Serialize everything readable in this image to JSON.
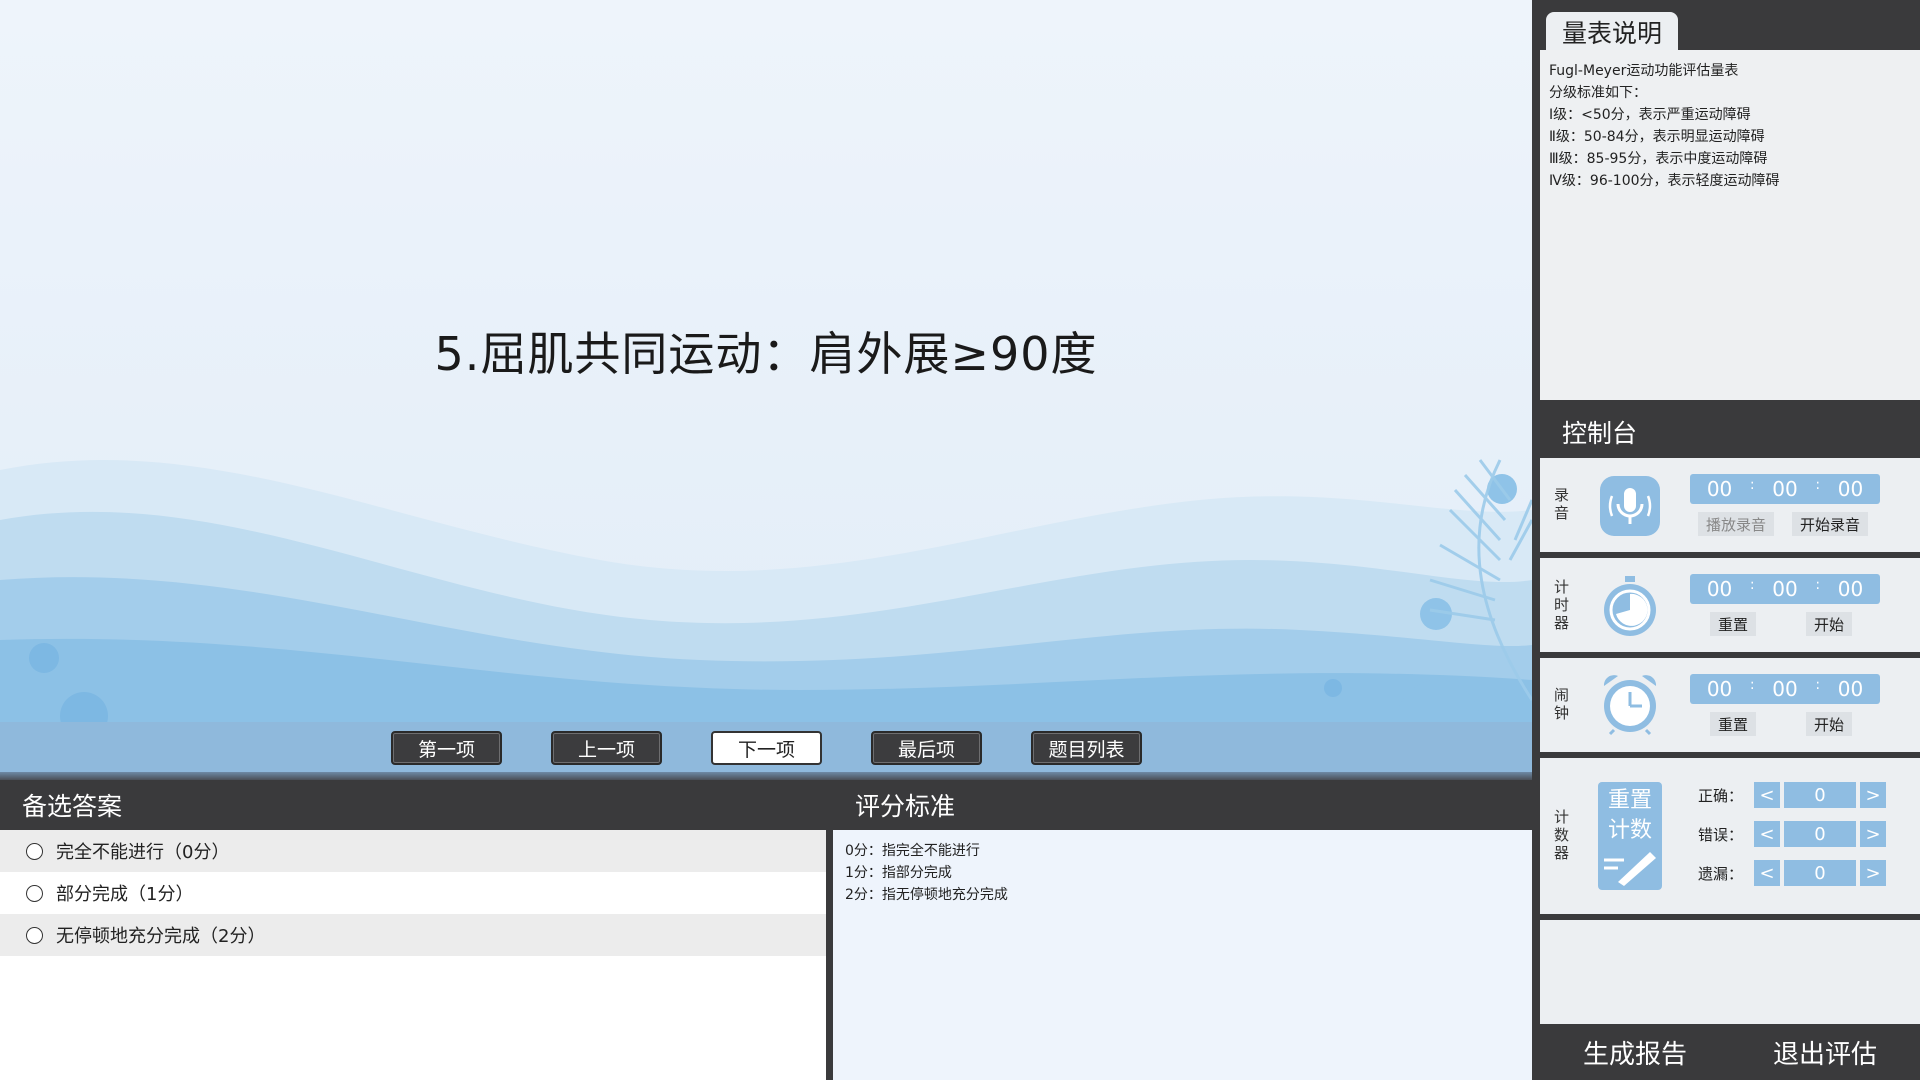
{
  "question": {
    "title": "5.屈肌共同运动：肩外展≥90度"
  },
  "nav": {
    "first": "第一项",
    "prev": "上一项",
    "next": "下一项",
    "last": "最后项",
    "list": "题目列表"
  },
  "answers": {
    "header": "备选答案",
    "options": [
      {
        "label": "完全不能进行（0分）"
      },
      {
        "label": "部分完成（1分）"
      },
      {
        "label": "无停顿地充分完成（2分）"
      }
    ]
  },
  "criteria": {
    "header": "评分标准",
    "lines": [
      "0分：指完全不能进行",
      "1分：指部分完成",
      "2分：指无停顿地充分完成"
    ]
  },
  "scale": {
    "tab": "量表说明",
    "lines": [
      "Fugl-Meyer运动功能评估量表",
      "分级标准如下：",
      "Ⅰ级：<50分，表示严重运动障碍",
      "Ⅱ级：50-84分，表示明显运动障碍",
      "Ⅲ级：85-95分，表示中度运动障碍",
      "Ⅳ级：96-100分，表示轻度运动障碍"
    ]
  },
  "console": {
    "header": "控制台",
    "record": {
      "label": [
        "录",
        "音"
      ],
      "icon": "microphone-icon",
      "time": [
        "00",
        "00",
        "00"
      ],
      "sep": ":",
      "play": "播放录音",
      "start": "开始录音"
    },
    "timer": {
      "label": [
        "计",
        "时",
        "器"
      ],
      "icon": "stopwatch-icon",
      "time": [
        "00",
        "00",
        "00"
      ],
      "sep": ":",
      "reset": "重置",
      "start": "开始"
    },
    "alarm": {
      "label": [
        "闹",
        "钟"
      ],
      "icon": "alarm-clock-icon",
      "time": [
        "00",
        "00",
        "00"
      ],
      "sep": ":",
      "reset": "重置",
      "start": "开始"
    },
    "counter": {
      "label": [
        "计",
        "数",
        "器"
      ],
      "icon_text": [
        "重置",
        "计数"
      ],
      "rows": [
        {
          "label": "正确：",
          "value": "0"
        },
        {
          "label": "错误：",
          "value": "0"
        },
        {
          "label": "遗漏：",
          "value": "0"
        }
      ],
      "dec": "<",
      "inc": ">"
    }
  },
  "actions": {
    "report": "生成报告",
    "exit": "退出评估"
  },
  "colors": {
    "accent": "#8fbde2",
    "dark": "#3a3a3c",
    "navbar": "#8fb9dc"
  }
}
